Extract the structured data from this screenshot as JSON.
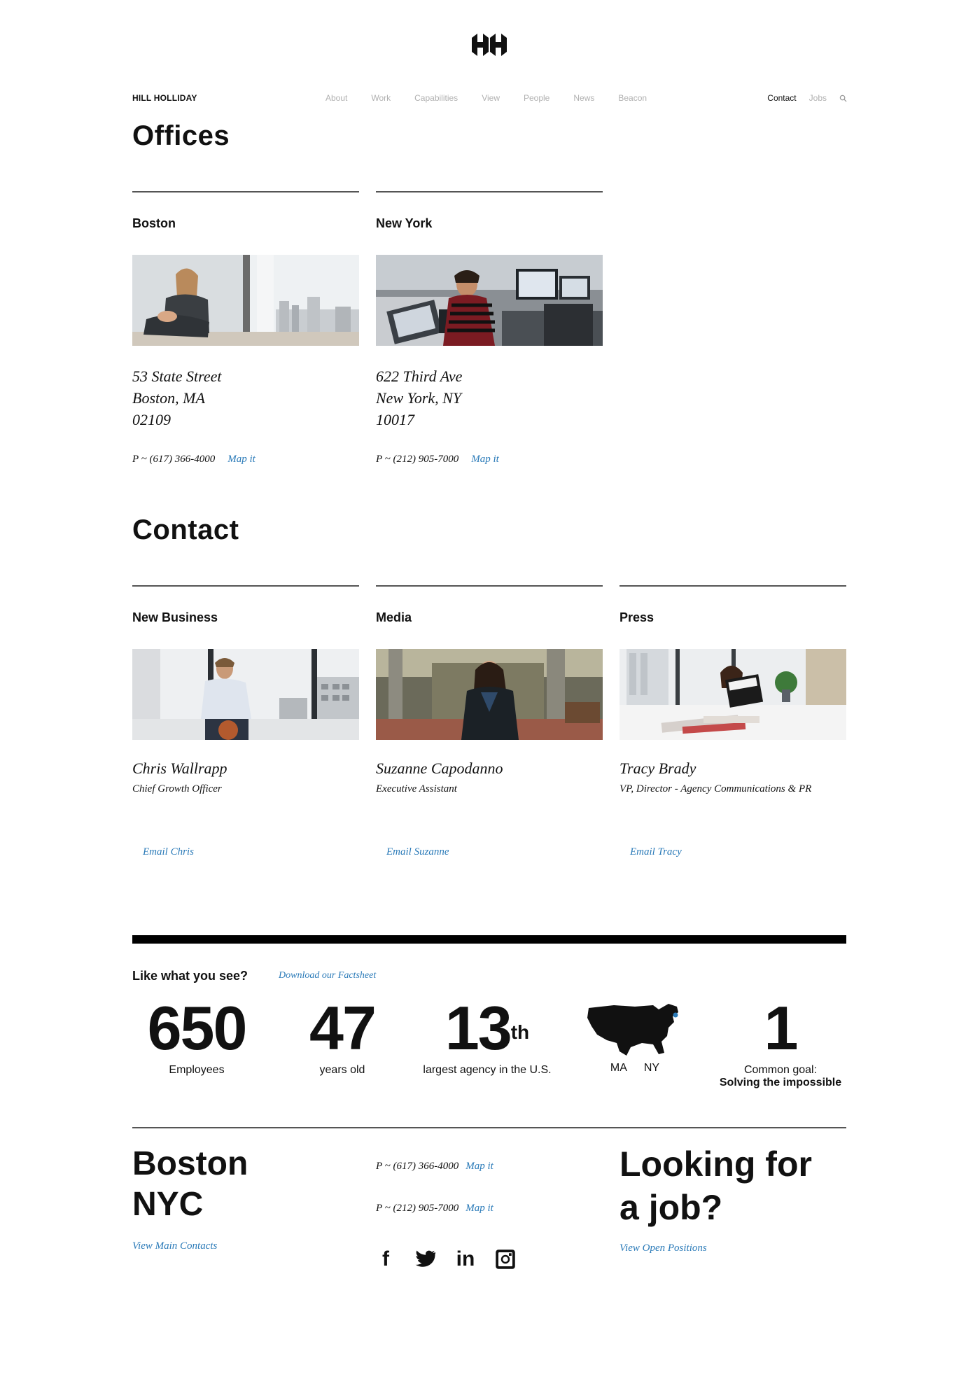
{
  "nav": {
    "brand": "HILL HOLLIDAY",
    "items": [
      "About",
      "Work",
      "Capabilities",
      "View",
      "People",
      "News",
      "Beacon"
    ],
    "contact": "Contact",
    "jobs": "Jobs"
  },
  "offices": {
    "title": "Offices",
    "boston": {
      "name": "Boston",
      "line1": "53 State Street",
      "line2": "Boston, MA",
      "line3": "02109",
      "phone": "P ~ (617) 366-4000",
      "map": "Map it"
    },
    "newyork": {
      "name": "New York",
      "line1": "622 Third Ave",
      "line2": "New York, NY",
      "line3": "10017",
      "phone": "P ~ (212) 905-7000",
      "map": "Map it"
    }
  },
  "contact": {
    "title": "Contact",
    "newbusiness": {
      "head": "New Business",
      "name": "Chris Wallrapp",
      "role": "Chief Growth Officer",
      "email": "Email Chris"
    },
    "media": {
      "head": "Media",
      "name": "Suzanne Capodanno",
      "role": "Executive Assistant",
      "email": "Email Suzanne"
    },
    "press": {
      "head": "Press",
      "name": "Tracy Brady",
      "role": "VP, Director - Agency Communications & PR",
      "email": "Email Tracy"
    }
  },
  "stats": {
    "heading": "Like what you see?",
    "factsheet": "Download our Factsheet",
    "employees_num": "650",
    "employees_lbl": "Employees",
    "years_num": "47",
    "years_lbl": "years old",
    "rank_num": "13",
    "rank_sup": "th",
    "rank_lbl": "largest agency in the U.S.",
    "map_ma": "MA",
    "map_ny": "NY",
    "goal_num": "1",
    "goal_lbl": "Common goal:",
    "goal_lbl2": "Solving the impossible"
  },
  "footer": {
    "city1": "Boston",
    "city2": "NYC",
    "view_main": "View Main Contacts",
    "phone1": "P ~ (617) 366-4000",
    "phone2": "P ~ (212) 905-7000",
    "map": "Map it",
    "job_line1": "Looking for",
    "job_line2": "a job?",
    "view_open": "View Open Positions",
    "social": {
      "facebook": "f",
      "linkedin": "in"
    }
  }
}
